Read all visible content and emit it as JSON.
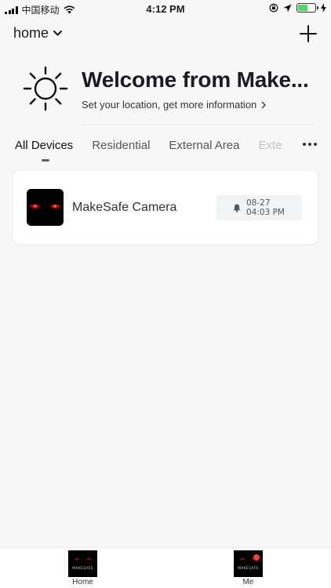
{
  "status_bar": {
    "carrier": "中国移动",
    "time": "4:12 PM",
    "battery_level": 0.55
  },
  "header": {
    "home_label": "home",
    "add_icon": "plus-icon"
  },
  "welcome": {
    "title": "Welcome from Make...",
    "subtitle": "Set your location, get more information",
    "icon": "sun-icon"
  },
  "tabs": [
    {
      "label": "All Devices"
    },
    {
      "label": "Residential"
    },
    {
      "label": "External Area"
    },
    {
      "label": "Exte"
    }
  ],
  "devices": [
    {
      "name": "MakeSafe Camera",
      "alert_date": "08-27",
      "alert_time": "04:03 PM",
      "alert_icon": "bell-icon"
    }
  ],
  "bottom_nav": {
    "home_label": "Home",
    "me_label": "Me",
    "brand_text": "MAKESAFE"
  },
  "colors": {
    "background": "#f7f7f7",
    "battery": "#4cd964",
    "badge": "#ff3b30",
    "eyes": "#d10000"
  }
}
